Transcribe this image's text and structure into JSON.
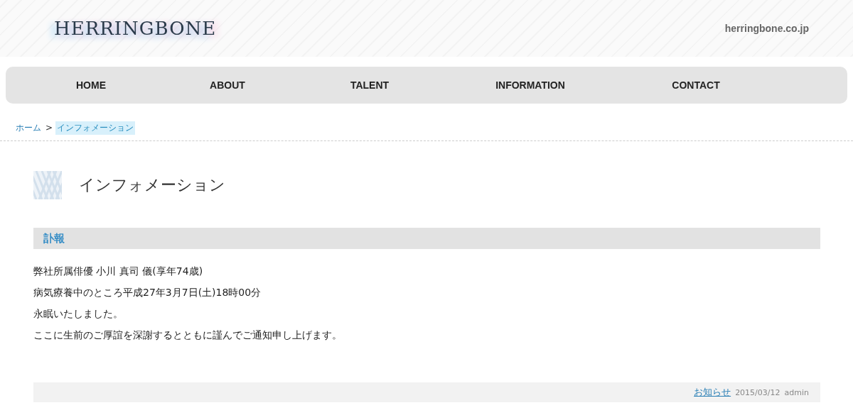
{
  "header": {
    "logo": "HERRINGBONE",
    "domain": "herringbone.co.jp"
  },
  "nav": [
    {
      "label": "HOME"
    },
    {
      "label": "ABOUT"
    },
    {
      "label": "TALENT"
    },
    {
      "label": "INFORMATION"
    },
    {
      "label": "CONTACT"
    }
  ],
  "breadcrumb": {
    "items": [
      {
        "label": "ホーム",
        "selected": false
      },
      {
        "label": "インフォメーション",
        "selected": true
      }
    ],
    "separator": ">"
  },
  "page_title": "インフォメーション",
  "post": {
    "title": "訃報",
    "lines": [
      "弊社所属俳優  小川 真司 儀(享年74歳)",
      "病気療養中のところ平成27年3月7日(土)18時00分",
      "永眠いたしました。",
      "ここに生前のご厚誼を深謝するとともに謹んでご通知申し上げます。"
    ],
    "category": "お知らせ",
    "date": "2015/03/12",
    "author": "admin"
  }
}
